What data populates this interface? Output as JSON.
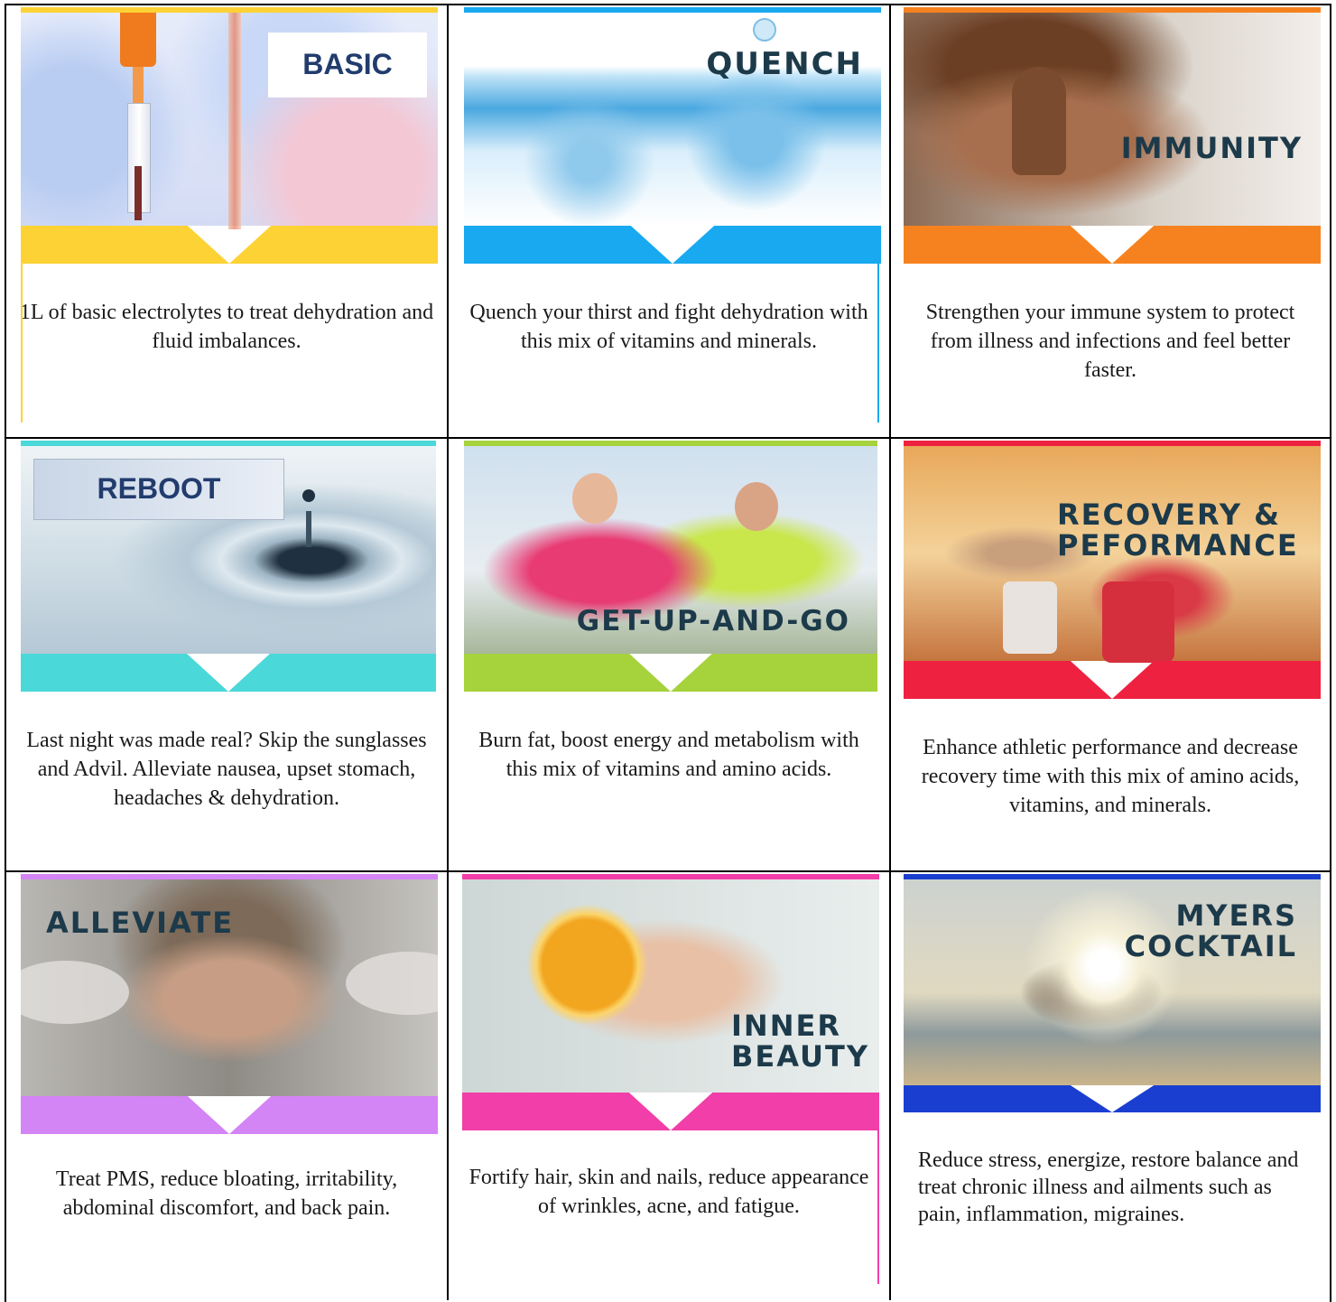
{
  "cards": [
    {
      "id": "basic",
      "label": "BASIC",
      "accent": "#fdd235",
      "description": "1L of basic electrolytes to treat dehydration and fluid imbalances.",
      "icon": "iv-drip-photo"
    },
    {
      "id": "quench",
      "label": "QUENCH",
      "accent": "#18a9f0",
      "description": "Quench your thirst and fight dehydration with this mix of vitamins and minerals.",
      "icon": "water-photo"
    },
    {
      "id": "immunity",
      "label": "IMMUNITY",
      "accent": "#f6821f",
      "description": "Strengthen your immune system to protect from illness and infections and feel better faster.",
      "icon": "woman-praying-photo"
    },
    {
      "id": "reboot",
      "label": "REBOOT",
      "accent": "#4bd8d9",
      "description": "Last night was made real? Skip the sunglasses and Advil. Alleviate nausea, upset stomach, headaches & dehydration.",
      "icon": "water-droplet-photo"
    },
    {
      "id": "get-up-and-go",
      "label": "GET-UP-AND-GO",
      "accent": "#a6d23c",
      "description": "Burn fat, boost energy and metabolism with this mix of vitamins and amino acids.",
      "icon": "runners-photo"
    },
    {
      "id": "recovery",
      "label": "RECOVERY & PEFORMANCE",
      "label_lines": [
        "RECOVERY &",
        "PEFORMANCE"
      ],
      "accent": "#ee2240",
      "description": "Enhance athletic performance and decrease recovery time with this mix of amino acids, vitamins, and minerals.",
      "icon": "running-shoes-photo"
    },
    {
      "id": "alleviate",
      "label": "ALLEVIATE",
      "accent": "#d384f5",
      "description": "Treat PMS, reduce bloating, irritability, abdominal discomfort, and back pain.",
      "icon": "frustrated-woman-photo"
    },
    {
      "id": "inner-beauty",
      "label": "INNER BEAUTY",
      "label_lines": [
        "INNER",
        "BEAUTY"
      ],
      "accent": "#f23ea8",
      "description": "Fortify hair, skin and nails, reduce appearance of wrinkles, acne, and fatigue.",
      "icon": "woman-orange-photo"
    },
    {
      "id": "myers",
      "label": "MYERS COCKTAIL",
      "label_lines": [
        "MYERS",
        "COCKTAIL"
      ],
      "accent": "#1a3fd0",
      "description": "Reduce stress, energize, restore balance and treat chronic illness and ailments such as pain, inflammation, migraines.",
      "icon": "yoga-pose-photo"
    }
  ]
}
